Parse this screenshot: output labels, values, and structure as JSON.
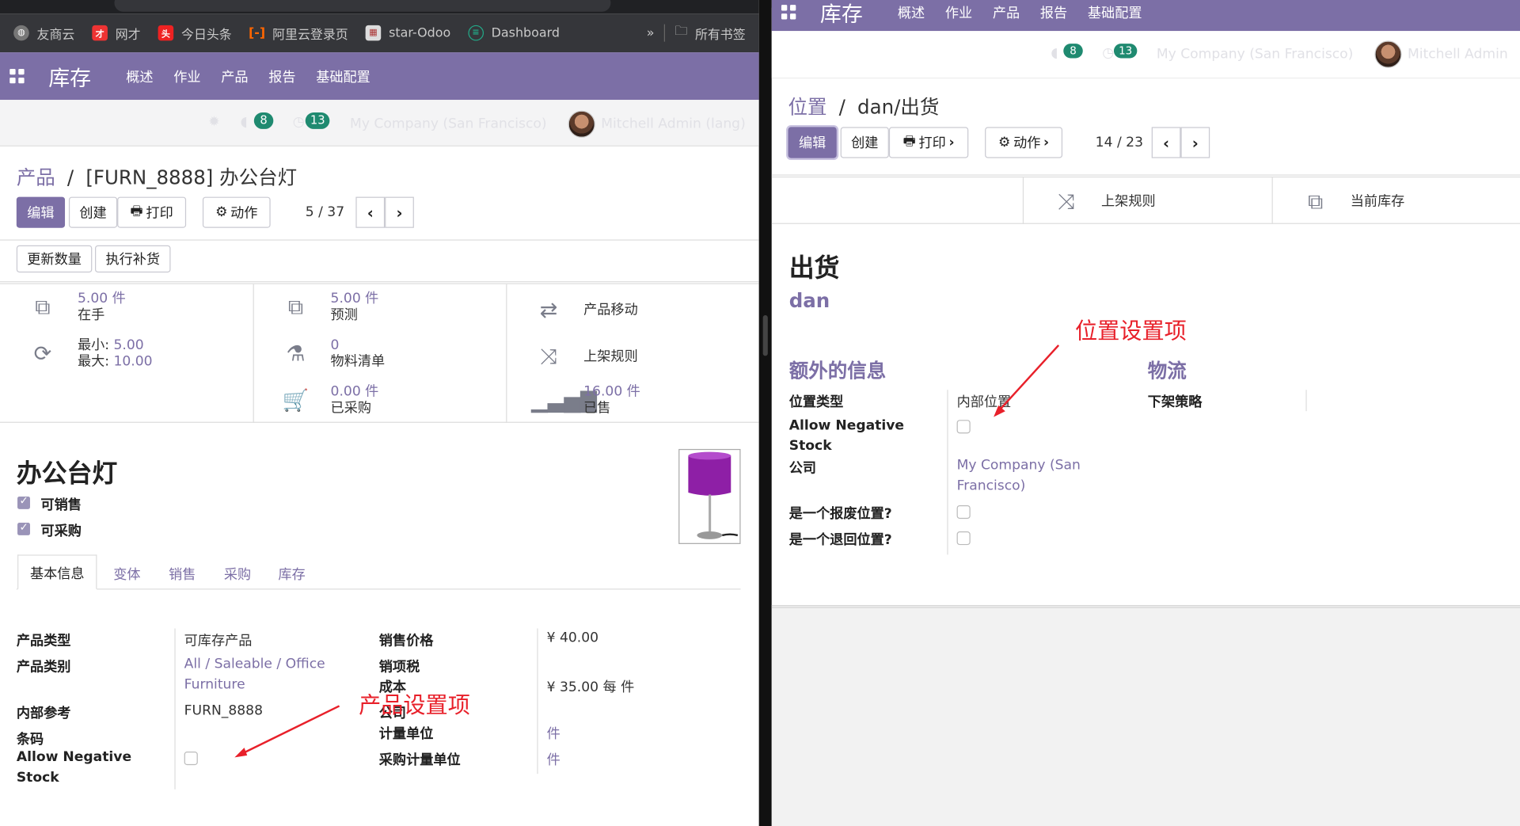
{
  "bookmarks": [
    {
      "label": "友商云",
      "icon": "globe-icon"
    },
    {
      "label": "网才",
      "icon": "wangcai-icon"
    },
    {
      "label": "今日头条",
      "icon": "toutiao-icon"
    },
    {
      "label": "阿里云登录页",
      "icon": "aliyun-icon"
    },
    {
      "label": "star-Odoo",
      "icon": "odoo-icon"
    },
    {
      "label": "Dashboard",
      "icon": "dashboard-icon"
    }
  ],
  "bookmarks_more": "»",
  "bookmarks_all": "所有书签",
  "left": {
    "app_name": "库存",
    "menus": [
      "概述",
      "作业",
      "产品",
      "报告",
      "基础配置"
    ],
    "badge_messages": "8",
    "badge_activities": "13",
    "company": "My Company (San Francisco)",
    "user": "Mitchell Admin (lang)",
    "breadcrumb_root": "产品",
    "breadcrumb_sep": "/",
    "breadcrumb_current": "[FURN_8888] 办公台灯",
    "btn_edit": "编辑",
    "btn_create": "创建",
    "btn_print": "打印",
    "btn_action": "动作",
    "pager": "5 / 37",
    "btn_update_qty": "更新数量",
    "btn_replenish": "执行补货",
    "stats": {
      "on_hand_value": "5.00 件",
      "on_hand_label": "在手",
      "forecast_value": "5.00 件",
      "forecast_label": "预测",
      "moves_label": "产品移动",
      "min_label": "最小:",
      "min_value": "5.00",
      "max_label": "最大:",
      "max_value": "10.00",
      "bom_value": "0",
      "bom_label": "物料清单",
      "putaway_label": "上架规则",
      "purchased_value": "0.00 件",
      "purchased_label": "已采购",
      "sold_value": "16.00 件",
      "sold_label": "已售"
    },
    "product_name": "办公台灯",
    "can_sell": "可销售",
    "can_purchase": "可采购",
    "tabs": [
      "基本信息",
      "变体",
      "销售",
      "采购",
      "库存"
    ],
    "fields_left": {
      "type_label": "产品类型",
      "type_value": "可库存产品",
      "categ_label": "产品类别",
      "categ_value_1": "All / Saleable / Office",
      "categ_value_2": "Furniture",
      "ref_label": "内部参考",
      "ref_value": "FURN_8888",
      "barcode_label": "条码",
      "neg_label_1": "Allow Negative",
      "neg_label_2": "Stock"
    },
    "fields_right": {
      "price_label": "销售价格",
      "price_value": "¥ 40.00",
      "tax_label": "销项税",
      "cost_label": "成本",
      "cost_value": "¥ 35.00 每 件",
      "company_label": "公司",
      "uom_label": "计量单位",
      "uom_value": "件",
      "po_uom_label": "采购计量单位",
      "po_uom_value": "件"
    },
    "annotation": "产品设置项"
  },
  "right": {
    "top_menus": [
      "库存",
      "概述",
      "作业",
      "产品",
      "报告",
      "基础配置"
    ],
    "badge_messages": "8",
    "badge_activities": "13",
    "company": "My Company (San Francisco)",
    "user": "Mitchell Admin",
    "breadcrumb_root": "位置",
    "breadcrumb_sep": "/",
    "breadcrumb_current": "dan/出货",
    "btn_edit": "编辑",
    "btn_create": "创建",
    "btn_print": "打印",
    "btn_action": "动作",
    "pager": "14 / 23",
    "smart_putaway": "上架规则",
    "smart_stock": "当前库存",
    "location_name": "出货",
    "parent_name": "dan",
    "section_extra": "额外的信息",
    "section_logistics": "物流",
    "loc_type_label": "位置类型",
    "loc_type_value": "内部位置",
    "neg_label_1": "Allow Negative",
    "neg_label_2": "Stock",
    "company_label": "公司",
    "company_value_1": "My Company (San",
    "company_value_2": "Francisco)",
    "scrap_label": "是一个报废位置?",
    "return_label": "是一个退回位置?",
    "removal_label": "下架策略",
    "annotation": "位置设置项"
  }
}
